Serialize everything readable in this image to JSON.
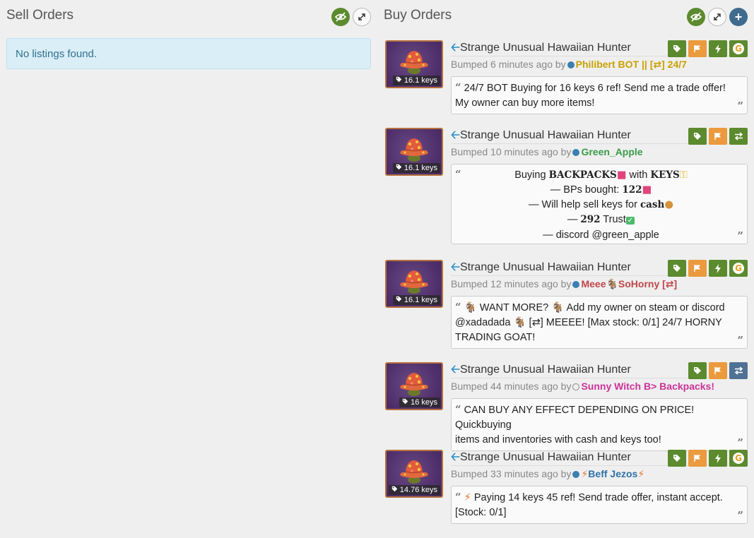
{
  "sell": {
    "title": "Sell Orders",
    "empty_message": "No listings found."
  },
  "buy": {
    "title": "Buy Orders"
  },
  "listings": [
    {
      "item_name": "Strange Unusual Hawaiian Hunter",
      "price": "16.1 keys",
      "bumped": "Bumped 6 minutes ago by",
      "user": "Philibert BOT || [⇄] 24/7",
      "user_color": "#c9a100",
      "status": "online",
      "line1": "24/7 BOT Buying for 16 keys 6 ref! Send me a trade offer!",
      "line2": "My owner can buy more items!"
    },
    {
      "item_name": "Strange Unusual Hawaiian Hunter",
      "price": "16.1 keys",
      "bumped": "Bumped 10 minutes ago by",
      "user": "Green_Apple",
      "user_color": "#3b9b4a",
      "status": "online",
      "l1a": "Buying ",
      "l1b": "BACKPACKS",
      "l1c": " with ",
      "l1d": "KEYS",
      "l2a": "— BPs bought: ",
      "l2b": "122",
      "l3a": "— Will help sell keys for ",
      "l3b": "cash",
      "l4a": "— ",
      "l4b": "292",
      "l4c": " Trust",
      "l5": "— discord @green_apple"
    },
    {
      "item_name": "Strange Unusual Hawaiian Hunter",
      "price": "16.1 keys",
      "bumped": "Bumped 12 minutes ago by",
      "user": "Meee",
      "user2": "SoHorny [⇄]",
      "user_color": "#c0464a",
      "status": "online",
      "t1": "WANT MORE?",
      "t2": "Add my owner on steam or discord",
      "t3": "@xadadada",
      "t4": "[⇄] MEEEE! [Max stock: 0/1] 24/7 HORNY",
      "t5": "TRADING GOAT!"
    },
    {
      "item_name": "Strange Unusual Hawaiian Hunter",
      "price": "16 keys",
      "bumped": "Bumped 44 minutes ago by",
      "user": "Sunny Witch B> Backpacks!",
      "user_color": "#cc3399",
      "status": "offline",
      "line1": "CAN BUY ANY EFFECT DEPENDING ON PRICE! Quickbuying",
      "line2": "items and inventories with cash and keys too!"
    },
    {
      "item_name": "Strange Unusual Hawaiian Hunter",
      "price": "14.76 keys",
      "bumped": "Bumped 33 minutes ago by",
      "user": "Beff Jezos",
      "user_color": "#2f72a8",
      "status": "online",
      "line1": "Paying 14 keys 45 ref! Send trade offer, instant accept.",
      "line2": "[Stock: 0/1]"
    }
  ]
}
